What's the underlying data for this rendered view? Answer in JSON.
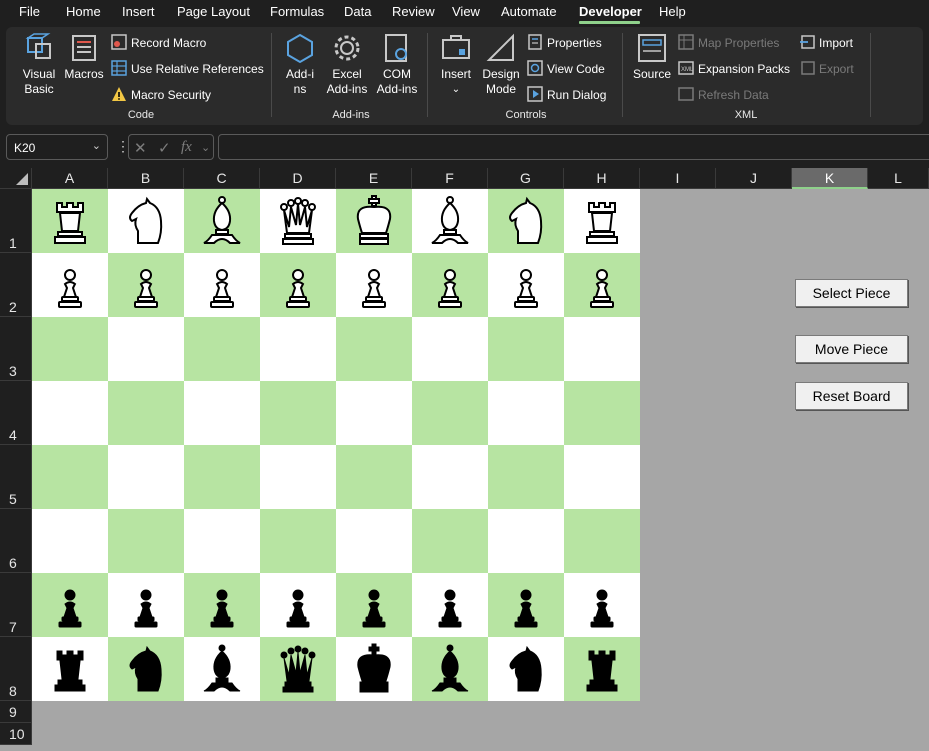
{
  "menu": {
    "items": [
      {
        "key": "file",
        "label": "File"
      },
      {
        "key": "home",
        "label": "Home"
      },
      {
        "key": "insert",
        "label": "Insert"
      },
      {
        "key": "page-layout",
        "label": "Page Layout"
      },
      {
        "key": "formulas",
        "label": "Formulas"
      },
      {
        "key": "data",
        "label": "Data"
      },
      {
        "key": "review",
        "label": "Review"
      },
      {
        "key": "view",
        "label": "View"
      },
      {
        "key": "automate",
        "label": "Automate"
      },
      {
        "key": "developer",
        "label": "Developer"
      },
      {
        "key": "help",
        "label": "Help"
      }
    ],
    "active": "Developer"
  },
  "ribbon": {
    "code": {
      "visual_basic": "Visual Basic",
      "macros": "Macros",
      "record_macro": "Record Macro",
      "use_relative_references": "Use Relative References",
      "macro_security": "Macro Security",
      "label": "Code"
    },
    "addins": {
      "add_ins": "Add-ins",
      "excel_add_ins": "Excel Add-ins",
      "com_add_ins": "COM Add-ins",
      "label": "Add-ins"
    },
    "controls": {
      "insert": "Insert",
      "design_mode": "Design Mode",
      "properties": "Properties",
      "view_code": "View Code",
      "run_dialog": "Run Dialog",
      "label": "Controls"
    },
    "xml": {
      "source": "Source",
      "map_properties": "Map Properties",
      "expansion_packs": "Expansion Packs",
      "refresh_data": "Refresh Data",
      "import": "Import",
      "export": "Export",
      "label": "XML"
    }
  },
  "formula_bar": {
    "name_box": "K20",
    "formula": ""
  },
  "columns": [
    "A",
    "B",
    "C",
    "D",
    "E",
    "F",
    "G",
    "H",
    "I",
    "J",
    "K",
    "L"
  ],
  "selected_column": "K",
  "rows": [
    "1",
    "2",
    "3",
    "4",
    "5",
    "6",
    "7",
    "8",
    "9",
    "10"
  ],
  "board": {
    "light_color": "#ffffff",
    "dark_color": "#b7e4a2",
    "squares": [
      [
        "white-rook",
        "white-knight",
        "white-bishop",
        "white-queen",
        "white-king",
        "white-bishop",
        "white-knight",
        "white-rook"
      ],
      [
        "white-pawn",
        "white-pawn",
        "white-pawn",
        "white-pawn",
        "white-pawn",
        "white-pawn",
        "white-pawn",
        "white-pawn"
      ],
      [
        "",
        "",
        "",
        "",
        "",
        "",
        "",
        ""
      ],
      [
        "",
        "",
        "",
        "",
        "",
        "",
        "",
        ""
      ],
      [
        "",
        "",
        "",
        "",
        "",
        "",
        "",
        ""
      ],
      [
        "",
        "",
        "",
        "",
        "",
        "",
        "",
        ""
      ],
      [
        "black-pawn",
        "black-pawn",
        "black-pawn",
        "black-pawn",
        "black-pawn",
        "black-pawn",
        "black-pawn",
        "black-pawn"
      ],
      [
        "black-rook",
        "black-knight",
        "black-bishop",
        "black-queen",
        "black-king",
        "black-bishop",
        "black-knight",
        "black-rook"
      ]
    ]
  },
  "buttons": {
    "select_piece": "Select Piece",
    "move_piece": "Move Piece",
    "reset_board": "Reset Board"
  },
  "colors": {
    "accent": "#8fd18b",
    "sheet_background": "#a6a6a6"
  }
}
